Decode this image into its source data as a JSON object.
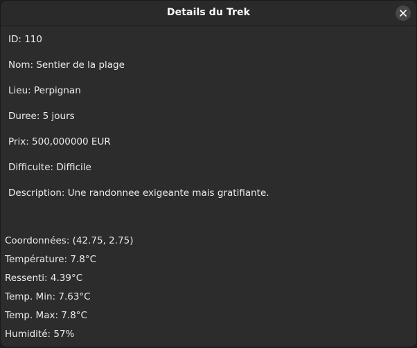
{
  "window": {
    "title": "Details du Trek",
    "close_icon": "close-icon"
  },
  "trek": {
    "id_line": "ID: 110",
    "nom_line": "Nom: Sentier de la plage",
    "lieu_line": "Lieu: Perpignan",
    "duree_line": "Duree: 5 jours",
    "prix_line": "Prix: 500,000000 EUR",
    "difficulte_line": "Difficulte: Difficile",
    "description_line": "Description: Une randonnee exigeante mais gratifiante."
  },
  "weather": {
    "coordonnees_line": "Coordonnées: (42.75, 2.75)",
    "temperature_line": "Température: 7.8°C",
    "ressenti_line": "Ressenti: 4.39°C",
    "temp_min_line": "Temp. Min: 7.63°C",
    "temp_max_line": "Temp. Max: 7.8°C",
    "humidite_line": "Humidité: 57%"
  },
  "colors": {
    "background": "#2c2c2c",
    "titlebar": "#2a2a2a",
    "text": "#ececec",
    "close_button": "#474747"
  }
}
